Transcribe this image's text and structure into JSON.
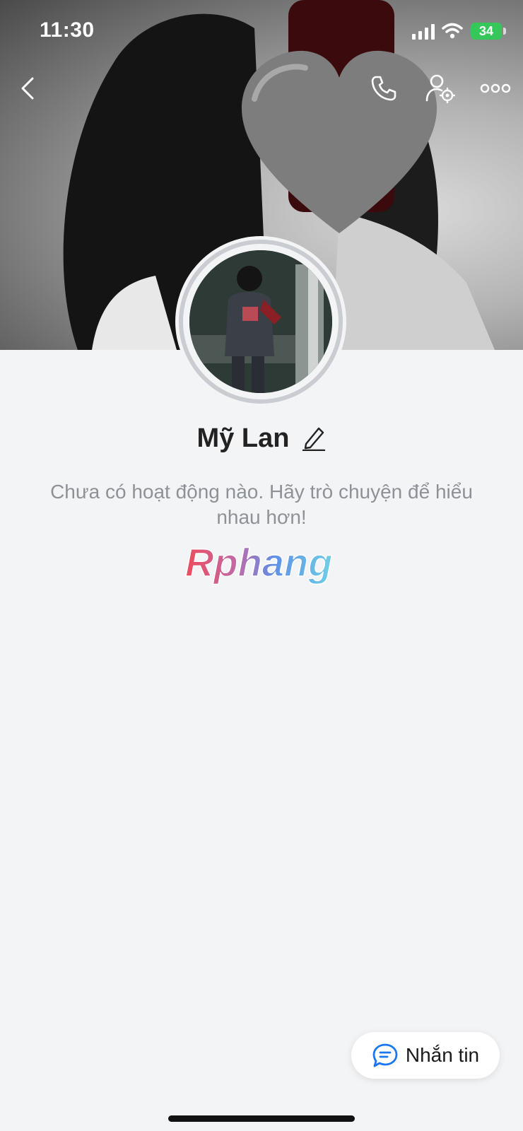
{
  "status_bar": {
    "time": "11:30",
    "battery": "34"
  },
  "profile": {
    "name": "Mỹ Lan",
    "empty_message": "Chưa có hoạt động nào. Hãy trò chuyện để hiểu nhau hơn!"
  },
  "brand_watermark": "Rphang",
  "actions": {
    "message_label": "Nhắn tin"
  },
  "icons": [
    "back-arrow-icon",
    "phone-icon",
    "user-settings-icon",
    "more-icon",
    "edit-pencil-icon",
    "chat-bubble-icon",
    "signal-icon",
    "wifi-icon",
    "battery-icon"
  ],
  "colors": {
    "accent": "#1877f2",
    "background": "#f3f4f6",
    "battery_green": "#35c759"
  }
}
